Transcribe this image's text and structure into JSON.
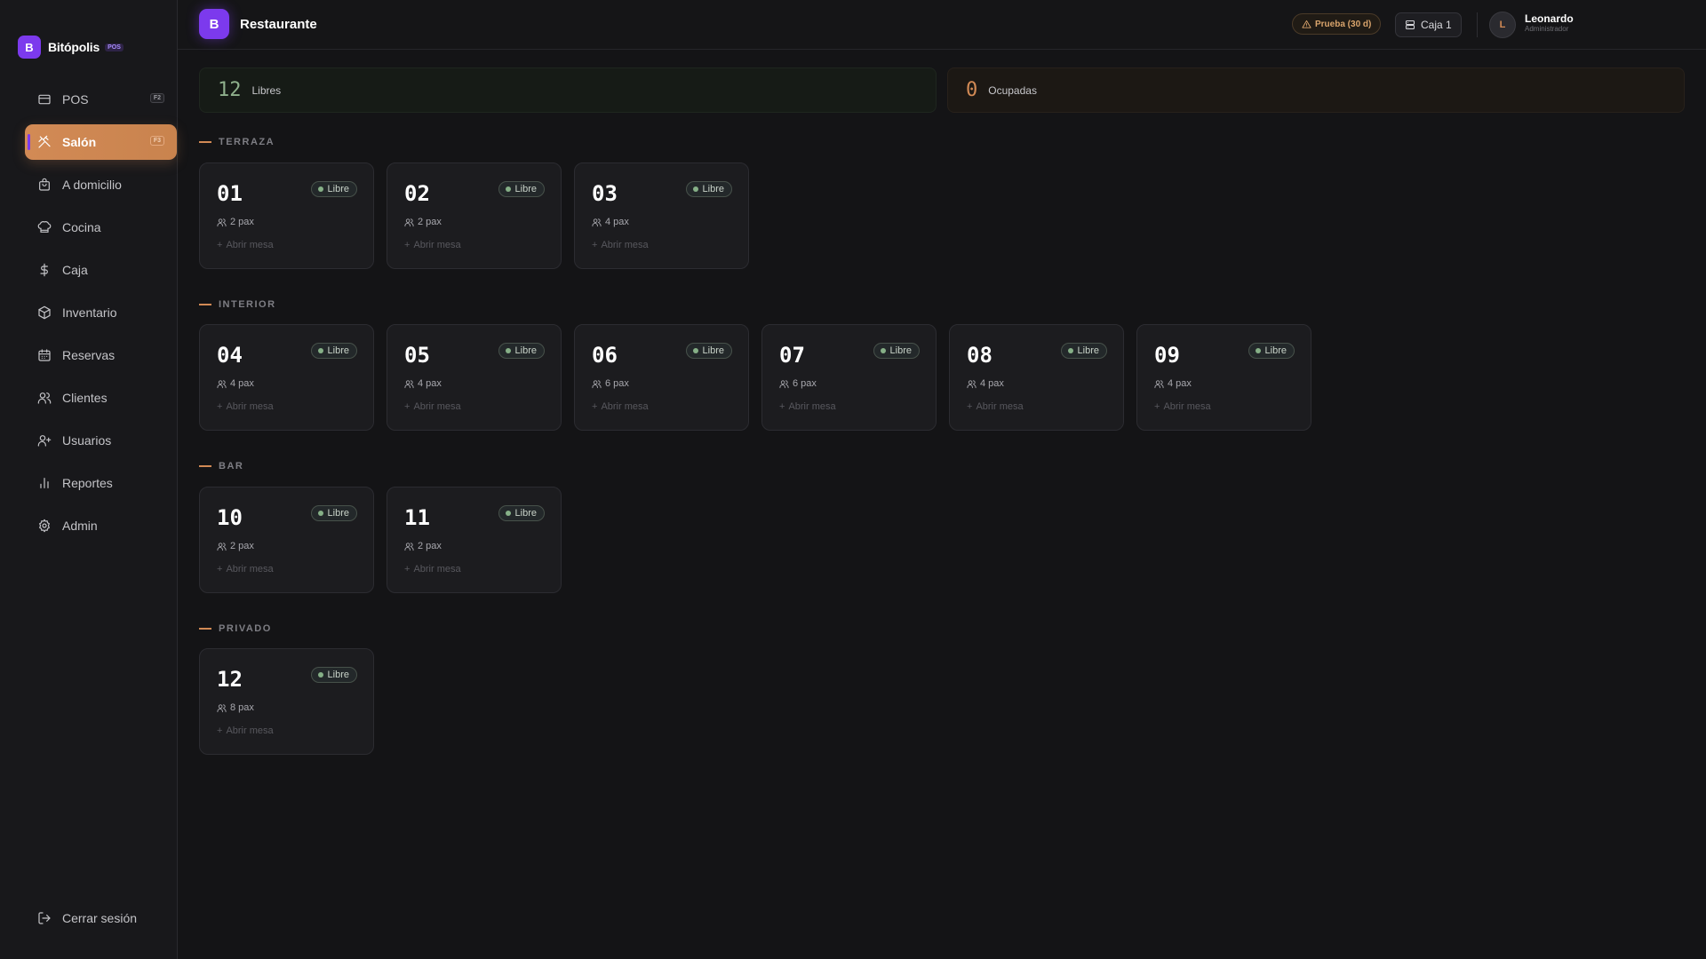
{
  "brand": {
    "logo_letter": "B",
    "name": "Bitópolis",
    "tag": "POS"
  },
  "sidebar": {
    "items": [
      {
        "label": "POS",
        "icon": "credit-card-icon",
        "shortcut": "F2"
      },
      {
        "label": "Salón",
        "icon": "utensils-crossed-icon",
        "shortcut": "F3",
        "active": true
      },
      {
        "label": "A domicilio",
        "icon": "shopping-bag-icon"
      },
      {
        "label": "Cocina",
        "icon": "chef-hat-icon"
      },
      {
        "label": "Caja",
        "icon": "dollar-sign-icon"
      },
      {
        "label": "Inventario",
        "icon": "package-icon"
      },
      {
        "label": "Reservas",
        "icon": "calendar-icon"
      },
      {
        "label": "Clientes",
        "icon": "users-icon"
      },
      {
        "label": "Usuarios",
        "icon": "user-plus-icon"
      },
      {
        "label": "Reportes",
        "icon": "bar-chart-icon"
      },
      {
        "label": "Admin",
        "icon": "gear-icon"
      }
    ],
    "logout_label": "Cerrar sesión"
  },
  "header": {
    "logo_letter": "B",
    "title": "Restaurante",
    "trial_label": "Prueba (30 d)",
    "register_label": "Caja 1",
    "user_initial": "L",
    "user_name": "Leonardo",
    "user_role": "Administrador"
  },
  "summary": {
    "free_count": "12",
    "free_label": "Libres",
    "busy_count": "0",
    "busy_label": "Ocupadas"
  },
  "colors": {
    "accent": "#d28a55",
    "brand": "#7c3aed",
    "free": "#86b087",
    "background": "#141416"
  },
  "zones": [
    {
      "name": "TERRAZA",
      "tables": [
        {
          "number": "01",
          "status": "Libre",
          "pax": "2 pax",
          "action": "Abrir mesa"
        },
        {
          "number": "02",
          "status": "Libre",
          "pax": "2 pax",
          "action": "Abrir mesa"
        },
        {
          "number": "03",
          "status": "Libre",
          "pax": "4 pax",
          "action": "Abrir mesa"
        }
      ]
    },
    {
      "name": "INTERIOR",
      "tables": [
        {
          "number": "04",
          "status": "Libre",
          "pax": "4 pax",
          "action": "Abrir mesa"
        },
        {
          "number": "05",
          "status": "Libre",
          "pax": "4 pax",
          "action": "Abrir mesa"
        },
        {
          "number": "06",
          "status": "Libre",
          "pax": "6 pax",
          "action": "Abrir mesa"
        },
        {
          "number": "07",
          "status": "Libre",
          "pax": "6 pax",
          "action": "Abrir mesa"
        },
        {
          "number": "08",
          "status": "Libre",
          "pax": "4 pax",
          "action": "Abrir mesa"
        },
        {
          "number": "09",
          "status": "Libre",
          "pax": "4 pax",
          "action": "Abrir mesa"
        }
      ]
    },
    {
      "name": "BAR",
      "tables": [
        {
          "number": "10",
          "status": "Libre",
          "pax": "2 pax",
          "action": "Abrir mesa"
        },
        {
          "number": "11",
          "status": "Libre",
          "pax": "2 pax",
          "action": "Abrir mesa"
        }
      ]
    },
    {
      "name": "PRIVADO",
      "tables": [
        {
          "number": "12",
          "status": "Libre",
          "pax": "8 pax",
          "action": "Abrir mesa"
        }
      ]
    }
  ]
}
